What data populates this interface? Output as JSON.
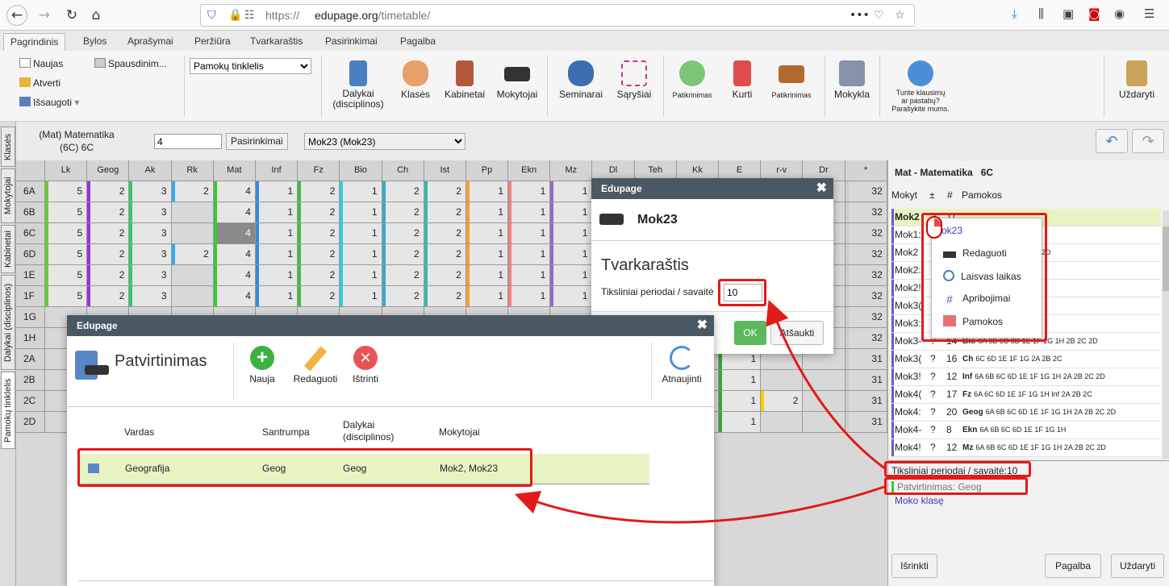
{
  "browser": {
    "url_prefix": "https://",
    "url_domain": "edupage.org",
    "url_path": "/timetable/",
    "dots": "•••"
  },
  "menu": {
    "tabs": [
      "Pagrindinis",
      "Bylos",
      "Aprašymai",
      "Peržiūra",
      "Tvarkaraštis",
      "Pasirinkimai",
      "Pagalba"
    ]
  },
  "ribbon": {
    "new": "Naujas",
    "open": "Atverti",
    "save": "Išsaugoti",
    "print": "Spausdinim...",
    "select_value": "Pamokų tinklelis",
    "subjects": "Dalykai\n(disciplinos)",
    "classes": "Klasės",
    "rooms": "Kabinetai",
    "teachers": "Mokytojai",
    "seminars": "Seminarai",
    "relations": "Sąryšiai",
    "check1": "Patikrinimas",
    "create": "Kurti",
    "check2": "Patikrinimas",
    "school": "Mokykla",
    "help": "Turite klausimų\nar pastabų?\nParašykite mums.",
    "close": "Uždaryti"
  },
  "toolbar": {
    "subject_title": "(Mat) Matematika",
    "class_title": "(6C) 6C",
    "count_value": "4",
    "options_label": "Pasirinkimai",
    "teacher_select": "Mok23 (Mok23)",
    "undo": "↶",
    "redo": "↷"
  },
  "vtabs": [
    "Klasės",
    "Mokytojai",
    "Kabinetai",
    "Dalykai (disciplinos)",
    "Pamokų tinklelis"
  ],
  "grid": {
    "headers": [
      "Lk",
      "Geog",
      "Ak",
      "Rk",
      "Mat",
      "Inf",
      "Fz",
      "Bio",
      "Ch",
      "Ist",
      "Pp",
      "Ekn",
      "Mz",
      "Dl",
      "Teh",
      "Kk",
      "E",
      "r-v",
      "Dr",
      "*"
    ],
    "rows": [
      {
        "label": "6A",
        "cells": [
          "5",
          "2",
          "3",
          "2",
          "4",
          "1",
          "2",
          "1",
          "2",
          "2",
          "1",
          "1",
          "1",
          "",
          "",
          "",
          "",
          "",
          "",
          "32"
        ]
      },
      {
        "label": "6B",
        "cells": [
          "5",
          "2",
          "3",
          "",
          "4",
          "1",
          "2",
          "1",
          "2",
          "2",
          "1",
          "1",
          "1",
          "",
          "",
          "",
          "",
          "",
          "",
          "32"
        ]
      },
      {
        "label": "6C",
        "cells": [
          "5",
          "2",
          "3",
          "",
          "4",
          "1",
          "2",
          "1",
          "2",
          "2",
          "1",
          "1",
          "1",
          "",
          "",
          "",
          "",
          "",
          "",
          "32"
        ]
      },
      {
        "label": "6D",
        "cells": [
          "5",
          "2",
          "3",
          "2",
          "4",
          "1",
          "2",
          "1",
          "2",
          "2",
          "1",
          "1",
          "1",
          "",
          "",
          "",
          "",
          "",
          "",
          "32"
        ]
      },
      {
        "label": "1E",
        "cells": [
          "5",
          "2",
          "3",
          "",
          "4",
          "1",
          "2",
          "1",
          "2",
          "2",
          "1",
          "1",
          "1",
          "",
          "",
          "",
          "",
          "",
          "",
          "32"
        ]
      },
      {
        "label": "1F",
        "cells": [
          "5",
          "2",
          "3",
          "",
          "4",
          "1",
          "2",
          "1",
          "2",
          "2",
          "1",
          "1",
          "1",
          "",
          "",
          "",
          "",
          "",
          "",
          "32"
        ]
      },
      {
        "label": "1G",
        "cells": [
          "",
          "",
          "",
          "",
          "",
          "",
          "",
          "",
          "",
          "",
          "",
          "",
          "",
          "",
          "",
          "",
          "",
          "",
          "",
          "32"
        ]
      },
      {
        "label": "1H",
        "cells": [
          "",
          "",
          "",
          "",
          "",
          "",
          "",
          "",
          "",
          "",
          "",
          "",
          "",
          "",
          "",
          "",
          "",
          "",
          "",
          "32"
        ]
      },
      {
        "label": "2A",
        "cells": [
          "",
          "",
          "",
          "",
          "",
          "",
          "",
          "",
          "",
          "",
          "",
          "",
          "",
          "",
          "",
          "",
          "1",
          "",
          "",
          "31"
        ]
      },
      {
        "label": "2B",
        "cells": [
          "",
          "",
          "",
          "",
          "",
          "",
          "",
          "",
          "",
          "",
          "",
          "",
          "",
          "",
          "",
          "",
          "1",
          "",
          "",
          "31"
        ]
      },
      {
        "label": "2C",
        "cells": [
          "",
          "",
          "",
          "",
          "",
          "",
          "",
          "",
          "",
          "",
          "",
          "",
          "",
          "",
          "",
          "",
          "1",
          "2",
          "",
          "31"
        ]
      },
      {
        "label": "2D",
        "cells": [
          "",
          "",
          "",
          "",
          "",
          "",
          "",
          "",
          "",
          "",
          "",
          "",
          "",
          "",
          "",
          "",
          "1",
          "",
          "",
          "31"
        ]
      }
    ]
  },
  "right_panel": {
    "title": "Mat - Matematika   6C",
    "col_teacher": "Mokyt",
    "col_pm": "±",
    "col_num": "#",
    "col_lessons": "Pamokos",
    "rows": [
      {
        "name": "Mok2",
        "q": "?",
        "n": "11",
        "subj": "",
        "classes": ""
      },
      {
        "name": "Mok1:",
        "q": "",
        "n": "",
        "subj": "",
        "classes": ""
      },
      {
        "name": "Mok2",
        "q": "",
        "n": "",
        "subj": "",
        "classes": "6D 1E 1F 1H 2A 2B 2C 2D"
      },
      {
        "name": "Mok2:",
        "q": "",
        "n": "",
        "subj": "",
        "classes": ""
      },
      {
        "name": "Mok2!",
        "q": "",
        "n": "",
        "subj": "",
        "classes": "2D"
      },
      {
        "name": "Mok3(",
        "q": "",
        "n": "",
        "subj": "",
        "classes": ""
      },
      {
        "name": "Mok3:",
        "q": "",
        "n": "",
        "subj": "",
        "classes": ""
      },
      {
        "name": "Mok3-",
        "q": "?",
        "n": "14",
        "subj": "Bio",
        "classes": "6A 6B 6C 6D 1E 1F 1G 1H 2B 2C 2D"
      },
      {
        "name": "Mok3(",
        "q": "?",
        "n": "16",
        "subj": "Ch",
        "classes": "6C 6D 1E 1F 1G 2A 2B 2C"
      },
      {
        "name": "Mok3!",
        "q": "?",
        "n": "12",
        "subj": "Inf",
        "classes": "6A 6B 6C 6D 1E 1F 1G 1H 2A 2B 2C 2D"
      },
      {
        "name": "Mok4(",
        "q": "?",
        "n": "17",
        "subj": "Fz",
        "classes": "6A 6C 6D 1E 1F 1G 1H  Inf 2A 2B 2C"
      },
      {
        "name": "Mok4:",
        "q": "?",
        "n": "20",
        "subj": "Geog",
        "classes": "6A 6B 6C 6D 1E 1F 1G 1H 2A 2B 2C 2D"
      },
      {
        "name": "Mok4-",
        "q": "?",
        "n": "8",
        "subj": "Ekn",
        "classes": "6A 6B 6C 6D 1E 1F 1G 1H"
      },
      {
        "name": "Mok4!",
        "q": "?",
        "n": "12",
        "subj": "Mz",
        "classes": "6A 6B 6C 6D 1E 1F 1G 1H 2A 2B 2C 2D"
      }
    ],
    "info_periods": "Tiksliniai periodai / savaitė:10",
    "info_check": "Patvirtinimas: Geog",
    "info_teaches": "Moko klasę",
    "btn_clear": "Išrinkti",
    "btn_help": "Pagalba",
    "btn_close": "Uždaryti"
  },
  "context_menu": {
    "title": "Mok23",
    "items": [
      "Redaguoti",
      "Laisvas laikas",
      "Apribojimai",
      "Pamokos"
    ]
  },
  "dialog_teacher": {
    "header": "Edupage",
    "name": "Mok23",
    "section": "Tvarkaraštis",
    "field_label": "Tiksliniai periodai / savaitė",
    "field_value": "10",
    "ok": "OK",
    "cancel": "Atšaukti"
  },
  "dialog_confirm": {
    "header": "Edupage",
    "title": "Patvirtinimas",
    "tool_new": "Nauja",
    "tool_edit": "Redaguoti",
    "tool_delete": "Ištrinti",
    "tool_refresh": "Atnaujinti",
    "columns": [
      "Vardas",
      "Santrumpa",
      "Dalykai\n(disciplinos)",
      "Mokytojai"
    ],
    "row": {
      "name": "Geografija",
      "short": "Geog",
      "subject": "Geog",
      "teachers": "Mok2, Mok23"
    }
  }
}
